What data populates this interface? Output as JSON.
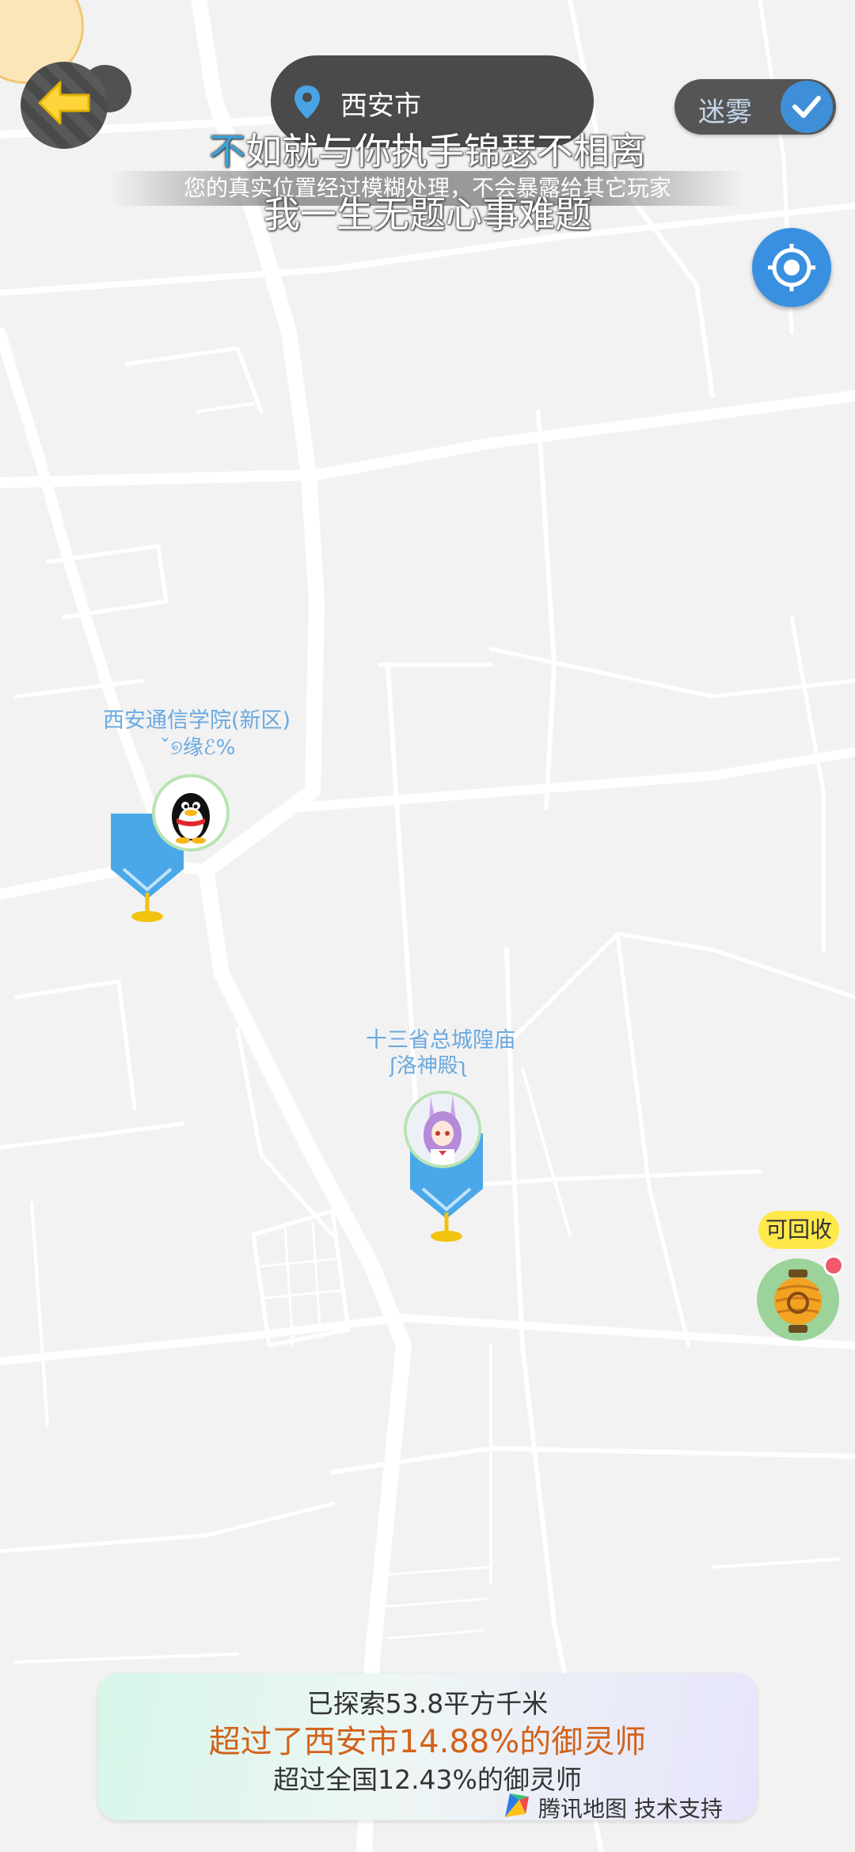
{
  "header": {
    "city": "西安市",
    "fog_label": "迷雾",
    "fog_enabled": true,
    "notice": "您的真实位置经过模糊处理，不会暴露给其它玩家"
  },
  "lyrics": {
    "line1_first": "不",
    "line1_rest": "如就与你执手锦瑟不相离",
    "line2": "我一生无题心事难题"
  },
  "markers": [
    {
      "title": "西安通信学院(新区)",
      "subtitle": "ˇ୭缘ℰ%",
      "avatar": "qq-penguin-icon"
    },
    {
      "title": "十三省总城隍庙",
      "subtitle": "ʃ洛神殿ʅ",
      "avatar": "anime-bunny-girl"
    }
  ],
  "recyclable": {
    "label": "可回收",
    "icon": "lantern-icon"
  },
  "stats": {
    "explored": "已探索53.8平方千米",
    "city_rank": "超过了西安市14.88%的御灵师",
    "country_rank": "超过全国12.43%的御灵师"
  },
  "attribution": {
    "text": "腾讯地图 技术支持",
    "icon": "tencent-map-logo"
  },
  "colors": {
    "map_bg": "#f2f2f2",
    "road": "#ffffff",
    "accent_blue": "#3a90e0",
    "marker_text": "#6aa9e0",
    "highlight_orange": "#d2621a",
    "tag_yellow": "#ffe84a"
  }
}
